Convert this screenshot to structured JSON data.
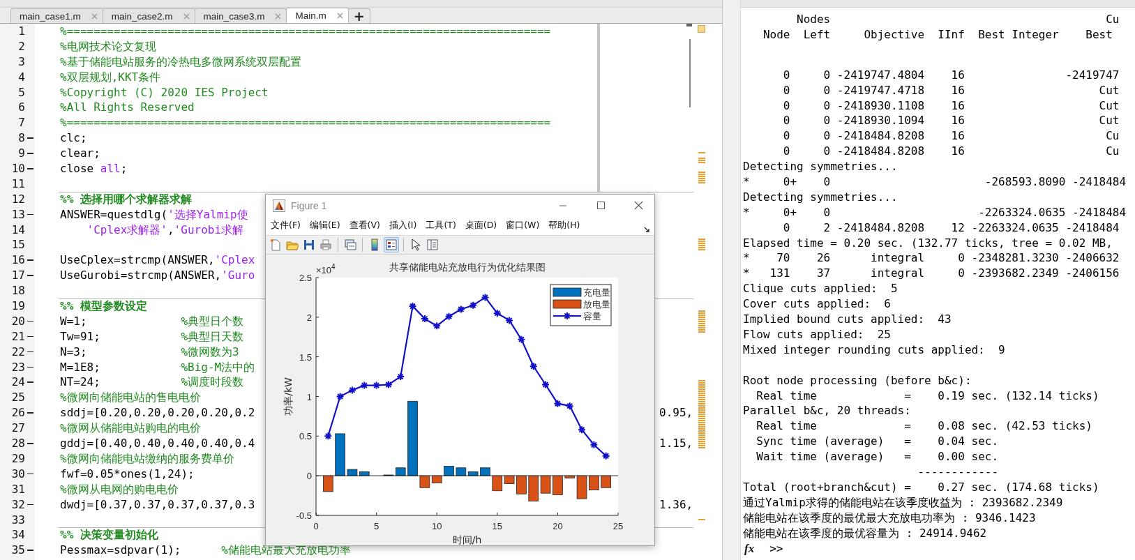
{
  "editor": {
    "tabs": [
      {
        "label": "main_case1.m",
        "selected": false
      },
      {
        "label": "main_case2.m",
        "selected": false
      },
      {
        "label": "main_case3.m",
        "selected": false
      },
      {
        "label": "Main.m",
        "selected": true
      }
    ],
    "new_tab": "+",
    "lines": [
      {
        "number": "1",
        "executable": false,
        "segments": [
          {
            "kind": "comment",
            "text": "%========================================================================"
          }
        ]
      },
      {
        "number": "2",
        "executable": false,
        "segments": [
          {
            "kind": "comment",
            "text": "%电网技术论文复现"
          }
        ]
      },
      {
        "number": "3",
        "executable": false,
        "segments": [
          {
            "kind": "comment",
            "text": "%基于储能电站服务的冷热电多微网系统双层配置"
          }
        ]
      },
      {
        "number": "4",
        "executable": false,
        "segments": [
          {
            "kind": "comment",
            "text": "%双层规划,KKT条件"
          }
        ]
      },
      {
        "number": "5",
        "executable": false,
        "segments": [
          {
            "kind": "comment",
            "text": "%Copyright (C) 2020 IES Project"
          }
        ]
      },
      {
        "number": "6",
        "executable": false,
        "segments": [
          {
            "kind": "comment",
            "text": "%All Rights Reserved"
          }
        ]
      },
      {
        "number": "7",
        "executable": false,
        "segments": [
          {
            "kind": "comment",
            "text": "%========================================================================"
          }
        ]
      },
      {
        "number": "8",
        "executable": true,
        "segments": [
          {
            "kind": "code",
            "text": "clc;"
          }
        ]
      },
      {
        "number": "9",
        "executable": true,
        "segments": [
          {
            "kind": "code",
            "text": "clear;"
          }
        ]
      },
      {
        "number": "10",
        "executable": true,
        "segments": [
          {
            "kind": "code",
            "text": "close "
          },
          {
            "kind": "string",
            "text": "all"
          },
          {
            "kind": "code",
            "text": ";"
          }
        ]
      },
      {
        "number": "11",
        "executable": false
      },
      {
        "number": "12",
        "executable": false,
        "segments": [
          {
            "kind": "section",
            "text": "%% 选择用哪个求解器求解"
          }
        ]
      },
      {
        "number": "13",
        "executable": true,
        "segments": [
          {
            "kind": "code",
            "text": "ANSWER=questdlg("
          },
          {
            "kind": "string",
            "text": "'选择Yalmip使"
          }
        ]
      },
      {
        "number": "14",
        "executable": false,
        "segments": [
          {
            "kind": "string",
            "text": "    'Cplex求解器'"
          },
          {
            "kind": "code",
            "text": ","
          },
          {
            "kind": "string",
            "text": "'Gurobi求解"
          }
        ]
      },
      {
        "number": "15",
        "executable": false
      },
      {
        "number": "16",
        "executable": true,
        "segments": [
          {
            "kind": "code",
            "text": "UseCplex=strcmp(ANSWER,"
          },
          {
            "kind": "string",
            "text": "'Cplex"
          }
        ]
      },
      {
        "number": "17",
        "executable": true,
        "segments": [
          {
            "kind": "code",
            "text": "UseGurobi=strcmp(ANSWER,"
          },
          {
            "kind": "string",
            "text": "'Guro"
          }
        ]
      },
      {
        "number": "18",
        "executable": false
      },
      {
        "number": "19",
        "executable": false,
        "segments": [
          {
            "kind": "section",
            "text": "%% 模型参数设定"
          }
        ]
      },
      {
        "number": "20",
        "executable": true,
        "segments": [
          {
            "kind": "code",
            "text": "W=1;              "
          },
          {
            "kind": "comment",
            "text": "%典型日个数"
          }
        ]
      },
      {
        "number": "21",
        "executable": true,
        "segments": [
          {
            "kind": "code",
            "text": "Tw=91;            "
          },
          {
            "kind": "comment",
            "text": "%典型日天数"
          }
        ]
      },
      {
        "number": "22",
        "executable": true,
        "segments": [
          {
            "kind": "code",
            "text": "N=3;              "
          },
          {
            "kind": "comment",
            "text": "%微网数为3"
          }
        ]
      },
      {
        "number": "23",
        "executable": true,
        "segments": [
          {
            "kind": "code",
            "text": "M=1E8;            "
          },
          {
            "kind": "comment",
            "text": "%Big-M法中的"
          }
        ]
      },
      {
        "number": "24",
        "executable": true,
        "segments": [
          {
            "kind": "code",
            "text": "NT=24;            "
          },
          {
            "kind": "comment",
            "text": "%调度时段数"
          }
        ]
      },
      {
        "number": "25",
        "executable": false,
        "segments": [
          {
            "kind": "comment",
            "text": "%微网向储能电站的售电电价"
          }
        ]
      },
      {
        "number": "26",
        "executable": true,
        "segments": [
          {
            "kind": "code",
            "text": "sddj=[0.20,0.20,0.20,0.20,0.2"
          }
        ],
        "tail": "0.95,"
      },
      {
        "number": "27",
        "executable": false,
        "segments": [
          {
            "kind": "comment",
            "text": "%微网从储能电站购电的电价"
          }
        ]
      },
      {
        "number": "28",
        "executable": true,
        "segments": [
          {
            "kind": "code",
            "text": "gddj=[0.40,0.40,0.40,0.40,0.4"
          }
        ],
        "tail": "1.15,"
      },
      {
        "number": "29",
        "executable": false,
        "segments": [
          {
            "kind": "comment",
            "text": "%微网向储能电站缴纳的服务费单价"
          }
        ]
      },
      {
        "number": "30",
        "executable": true,
        "segments": [
          {
            "kind": "code",
            "text": "fwf=0.05*ones(1,24);"
          }
        ]
      },
      {
        "number": "31",
        "executable": false,
        "segments": [
          {
            "kind": "comment",
            "text": "%微网从电网的购电电价"
          }
        ]
      },
      {
        "number": "32",
        "executable": true,
        "segments": [
          {
            "kind": "code",
            "text": "dwdj=[0.37,0.37,0.37,0.37,0.3"
          }
        ],
        "tail": "1.36,"
      },
      {
        "number": "33",
        "executable": false
      },
      {
        "number": "34",
        "executable": false,
        "segments": [
          {
            "kind": "section",
            "text": "%% 决策变量初始化"
          }
        ]
      },
      {
        "number": "35",
        "executable": true,
        "segments": [
          {
            "kind": "code",
            "text": "Pessmax=sdpvar(1);      "
          },
          {
            "kind": "comment",
            "text": "%储能电站最大充放电功率"
          }
        ]
      }
    ]
  },
  "command_window": {
    "blocks": [
      {
        "lines": [
          "        Nodes                                         Cu",
          "   Node  Left     Objective  IInf  Best Integer    Best"
        ]
      },
      {
        "lines": [
          "      0     0 -2419747.4804    16               -2419747",
          "      0     0 -2419747.4718    16                    Cut",
          "      0     0 -2418930.1108    16                    Cut",
          "      0     0 -2418930.1094    16                    Cut",
          "      0     0 -2418484.8208    16                     Cu",
          "      0     0 -2418484.8208    16                     Cu",
          "Detecting symmetries...",
          "*     0+    0                       -268593.8090 -2418484",
          "Detecting symmetries...",
          "*     0+    0                      -2263324.0635 -2418484",
          "      0     2 -2418484.8208    12 -2263324.0635 -2418484",
          "Elapsed time = 0.20 sec. (132.77 ticks, tree = 0.02 MB,",
          "*    70    26      integral     0 -2348281.3230 -2406632",
          "*   131    37      integral     0 -2393682.2349 -2406156",
          "Clique cuts applied:  5",
          "Cover cuts applied:  6",
          "Implied bound cuts applied:  43",
          "Flow cuts applied:  25",
          "Mixed integer rounding cuts applied:  9"
        ]
      },
      {
        "lines": [
          "Root node processing (before b&c):",
          "  Real time             =    0.19 sec. (132.14 ticks)",
          "Parallel b&c, 20 threads:",
          "  Real time             =    0.08 sec. (42.53 ticks)",
          "  Sync time (average)   =    0.04 sec.",
          "  Wait time (average)   =    0.00 sec.",
          "                          ------------",
          "Total (root+branch&cut) =    0.27 sec. (174.68 ticks)",
          "通过Yalmip求得的储能电站在该季度收益为 : 2393682.2349",
          "储能电站在该季度的最优最大充放电功率为 : 9346.1423",
          "储能电站在该季度的最优容量为 : 24914.9462"
        ]
      }
    ],
    "function_button": "fx",
    "prompt": ">>"
  },
  "figure": {
    "title": "Figure 1",
    "menu": [
      "文件(F)",
      "编辑(E)",
      "查看(V)",
      "插入(I)",
      "工具(T)",
      "桌面(D)",
      "窗口(W)",
      "帮助(H)"
    ],
    "toolbar": [
      {
        "kind": "new",
        "selected": false
      },
      {
        "kind": "open",
        "selected": false
      },
      {
        "kind": "save",
        "selected": false
      },
      {
        "kind": "print",
        "selected": false
      },
      {
        "kind": "separator"
      },
      {
        "kind": "link",
        "selected": false
      },
      {
        "kind": "separator"
      },
      {
        "kind": "colorbar",
        "selected": false
      },
      {
        "kind": "legend",
        "selected": true
      },
      {
        "kind": "separator"
      },
      {
        "kind": "pointer",
        "selected": false
      },
      {
        "kind": "inspector",
        "selected": false
      }
    ],
    "y_multiplier": {
      "base": "×10",
      "exponent": "4"
    },
    "chart_data": {
      "type": "bar",
      "title": "共享储能电站充放电行为优化结果图",
      "xlabel": "时间/h",
      "ylabel": "功率/kW",
      "x": [
        1,
        2,
        3,
        4,
        5,
        6,
        7,
        8,
        9,
        10,
        11,
        12,
        13,
        14,
        15,
        16,
        17,
        18,
        19,
        20,
        21,
        22,
        23,
        24
      ],
      "series": [
        {
          "name": "充电量",
          "color": "#0072bd",
          "type": "bar",
          "values": [
            0,
            0.53,
            0.08,
            0.05,
            0,
            0.01,
            0.1,
            0.94,
            0,
            0,
            0.12,
            0.1,
            0.05,
            0.1,
            0,
            0,
            0,
            0,
            0,
            0,
            0,
            0,
            0,
            0
          ]
        },
        {
          "name": "放电量",
          "color": "#d95319",
          "type": "bar",
          "values": [
            -0.2,
            0,
            0,
            0,
            0,
            0,
            0,
            0,
            -0.15,
            -0.09,
            0,
            0,
            0,
            0,
            -0.19,
            -0.1,
            -0.23,
            -0.32,
            -0.22,
            -0.24,
            -0.03,
            -0.29,
            -0.18,
            -0.15
          ]
        },
        {
          "name": "容量",
          "color": "#1010c8",
          "type": "line",
          "marker": "cross",
          "values": [
            0.5,
            1.0,
            1.08,
            1.14,
            1.14,
            1.15,
            1.25,
            2.14,
            1.98,
            1.89,
            2.01,
            2.1,
            2.15,
            2.25,
            2.05,
            1.96,
            1.72,
            1.38,
            1.15,
            0.91,
            0.88,
            0.58,
            0.39,
            0.25
          ]
        }
      ],
      "legend": true,
      "xlim": [
        0,
        25
      ],
      "ylim": [
        -0.5,
        2.5
      ],
      "xticks": [
        0,
        5,
        10,
        15,
        20,
        25
      ],
      "yticks": [
        -0.5,
        0,
        0.5,
        1,
        1.5,
        2,
        2.5
      ]
    }
  }
}
